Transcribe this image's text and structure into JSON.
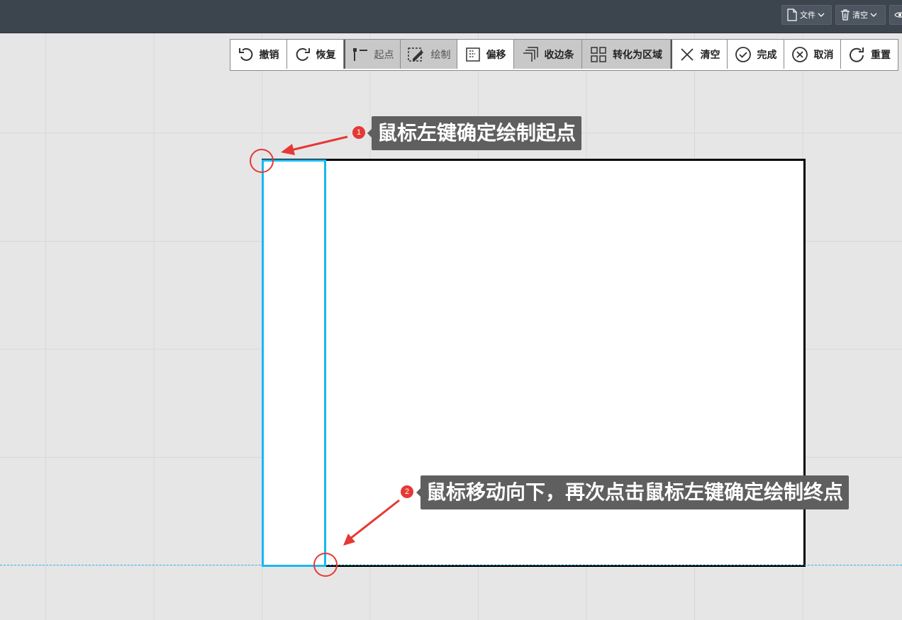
{
  "topbar": {
    "file_label": "文件",
    "clear_label": "清空"
  },
  "toolbar": {
    "undo": "撤销",
    "redo": "恢复",
    "start_point": "起点",
    "draw": "绘制",
    "offset": "偏移",
    "edge_strip": "收边条",
    "to_region": "转化为区域",
    "clear": "清空",
    "finish": "完成",
    "cancel": "取消",
    "reset": "重置"
  },
  "annotations": [
    {
      "number": "1",
      "text": "鼠标左键确定绘制起点"
    },
    {
      "number": "2",
      "text": "鼠标移动向下，再次点击鼠标左键确定绘制终点"
    }
  ],
  "colors": {
    "accent_blue": "#17b8ef",
    "marker_red": "#e53935",
    "topbar": "#3c444e"
  }
}
